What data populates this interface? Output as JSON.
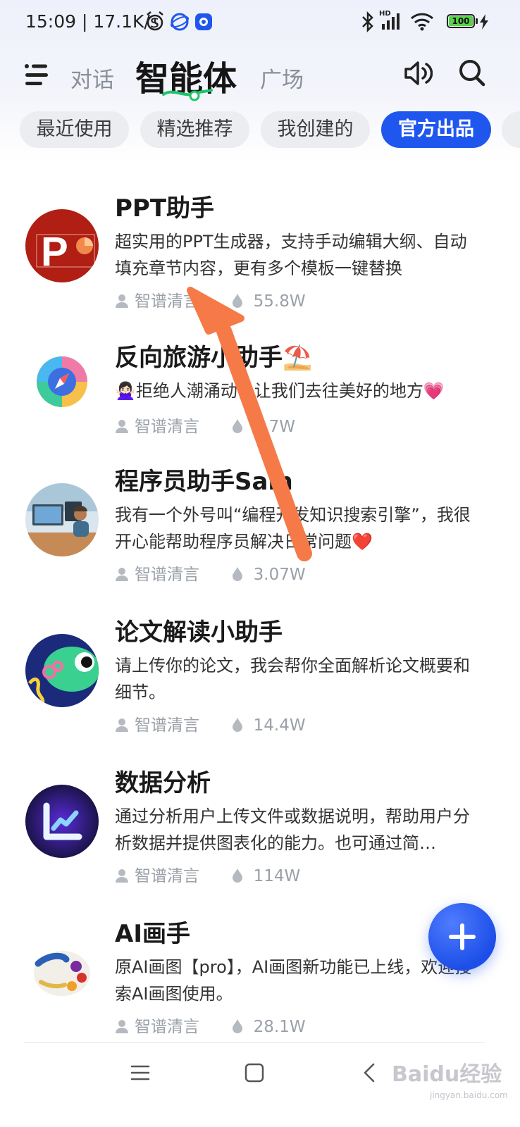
{
  "status_bar": {
    "time": "15:09 | 17.1K/s",
    "battery_level": "100",
    "network": "HD"
  },
  "header": {
    "tabs": [
      {
        "label": "对话"
      },
      {
        "label": "智能体"
      },
      {
        "label": "广场"
      }
    ],
    "active_tab": "智能体"
  },
  "categories": [
    {
      "label": "最近使用"
    },
    {
      "label": "精选推荐"
    },
    {
      "label": "我创建的"
    },
    {
      "label": "官方出品"
    }
  ],
  "active_category": "官方出品",
  "agents": [
    {
      "name": "PPT助手",
      "description": "超实用的PPT生成器，支持手动编辑大纲、自动填充章节内容，更有多个模板一键替换",
      "author": "智谱清言",
      "uses": "55.8W",
      "icon": "ppt-logo"
    },
    {
      "name": "反向旅游小助手⛱️",
      "description": "🙅🏻‍♀️拒绝人潮涌动，让我们去往美好的地方💗",
      "author": "智谱清言",
      "uses": "1.7W",
      "icon": "compass-logo"
    },
    {
      "name": "程序员助手Sam",
      "description": "我有一个外号叫“编程开发知识搜索引擎”，我很开心能帮助程序员解决日常问题❤️",
      "author": "智谱清言",
      "uses": "3.07W",
      "icon": "programmer-illustration"
    },
    {
      "name": "论文解读小助手",
      "description": "请上传你的论文，我会帮你全面解析论文概要和细节。",
      "author": "智谱清言",
      "uses": "14.4W",
      "icon": "fish-illustration"
    },
    {
      "name": "数据分析",
      "description": "通过分析用户上传文件或数据说明，帮助用户分析数据并提供图表化的能力。也可通过简…",
      "author": "智谱清言",
      "uses": "114W",
      "icon": "chart-logo"
    },
    {
      "name": "AI画手",
      "description": "原AI画图【pro】，AI画图新功能已上线，欢迎搜索AI画图使用。",
      "author": "智谱清言",
      "uses": "28.1W",
      "icon": "palette-illustration"
    }
  ],
  "watermark": {
    "text": "Baidu经验",
    "sub": "jingyan.baidu.com"
  },
  "colors": {
    "accent": "#1f57ee",
    "annotation_arrow": "#f57a48"
  }
}
